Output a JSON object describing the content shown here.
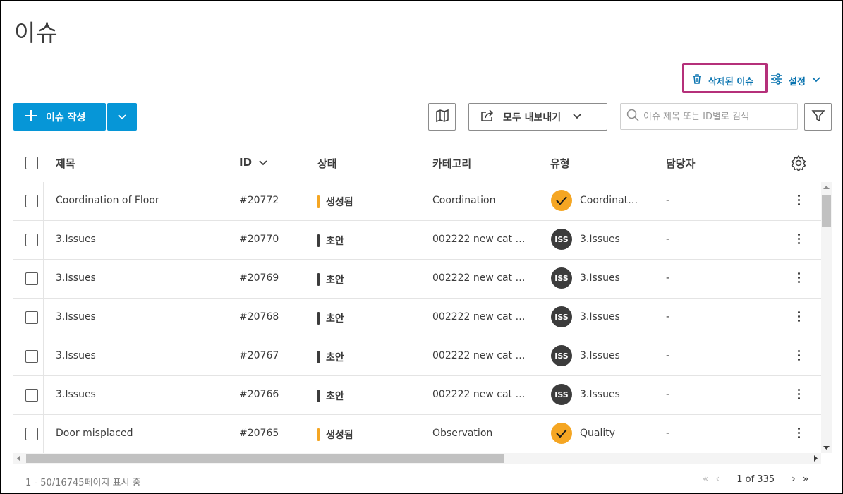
{
  "page": {
    "title": "이슈"
  },
  "header_links": {
    "deleted": "삭제된 이슈",
    "settings": "설정"
  },
  "toolbar": {
    "create_label": "이슈 작성",
    "export_label": "모두 내보내기",
    "search_placeholder": "이슈 제목 또는 ID별로 검색"
  },
  "table": {
    "columns": {
      "title": "제목",
      "id": "ID",
      "status": "상태",
      "category": "카테고리",
      "type": "유형",
      "assignee": "담당자"
    },
    "rows": [
      {
        "title": "Coordination of Floor",
        "id": "#20772",
        "status": "생성됨",
        "status_color": "#f5a623",
        "category": "Coordination",
        "type_icon": "check",
        "type": "Coordinat…",
        "assignee": "-"
      },
      {
        "title": "3.Issues",
        "id": "#20770",
        "status": "초안",
        "status_color": "#3c3c3c",
        "category": "002222 new cat …",
        "type_icon": "ISS",
        "type": "3.Issues",
        "assignee": "-"
      },
      {
        "title": "3.Issues",
        "id": "#20769",
        "status": "초안",
        "status_color": "#3c3c3c",
        "category": "002222 new cat …",
        "type_icon": "ISS",
        "type": "3.Issues",
        "assignee": "-"
      },
      {
        "title": "3.Issues",
        "id": "#20768",
        "status": "초안",
        "status_color": "#3c3c3c",
        "category": "002222 new cat …",
        "type_icon": "ISS",
        "type": "3.Issues",
        "assignee": "-"
      },
      {
        "title": "3.Issues",
        "id": "#20767",
        "status": "초안",
        "status_color": "#3c3c3c",
        "category": "002222 new cat …",
        "type_icon": "ISS",
        "type": "3.Issues",
        "assignee": "-"
      },
      {
        "title": "3.Issues",
        "id": "#20766",
        "status": "초안",
        "status_color": "#3c3c3c",
        "category": "002222 new cat …",
        "type_icon": "ISS",
        "type": "3.Issues",
        "assignee": "-"
      },
      {
        "title": "Door misplaced",
        "id": "#20765",
        "status": "생성됨",
        "status_color": "#f5a623",
        "category": "Observation",
        "type_icon": "check",
        "type": "Quality",
        "assignee": "-"
      }
    ]
  },
  "footer": {
    "showing": "1 - 50/16745페이지 표시 중",
    "page_current": "1",
    "page_of": "of 335"
  },
  "colors": {
    "accent": "#0696d7",
    "link": "#0a74b0",
    "highlight_box": "#b5307a",
    "status_created": "#f5a623",
    "status_draft": "#3c3c3c"
  }
}
